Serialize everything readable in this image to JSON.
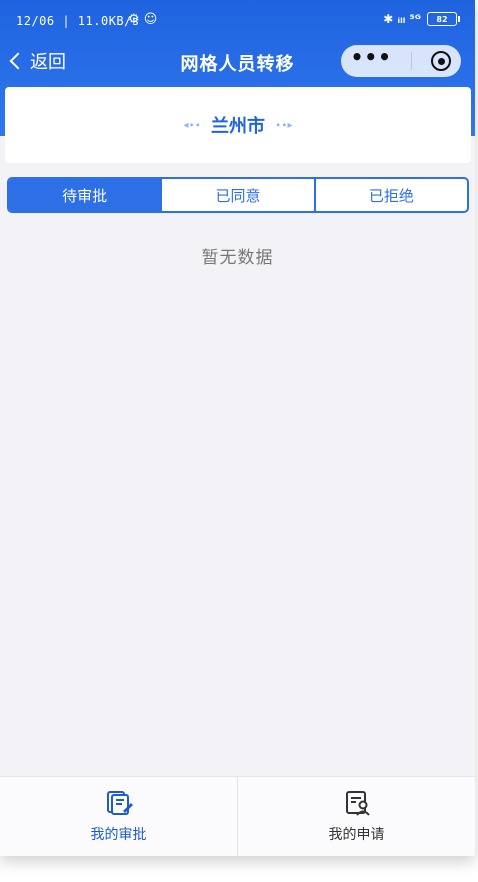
{
  "status_bar": {
    "time": "12/06 | 11.0KB/s",
    "left_icons": "⚙ ☺",
    "signal_text": "✱ ᵢₗₗ ⁵ᴳ",
    "battery_text": "82"
  },
  "nav": {
    "back_label": "返回",
    "title": "网格人员转移"
  },
  "city": {
    "name": "兰州市"
  },
  "tabs": [
    {
      "label": "待审批",
      "active": true
    },
    {
      "label": "已同意",
      "active": false
    },
    {
      "label": "已拒绝",
      "active": false
    }
  ],
  "empty": {
    "text": "暂无数据"
  },
  "bottom_bar": {
    "items": [
      {
        "label": "我的审批",
        "icon": "approval-icon",
        "active": true
      },
      {
        "label": "我的申请",
        "icon": "application-icon",
        "active": false
      }
    ]
  },
  "colors": {
    "primary": "#1f63e0",
    "tab_border": "#2c6fe6",
    "background": "#f3f3f7"
  }
}
